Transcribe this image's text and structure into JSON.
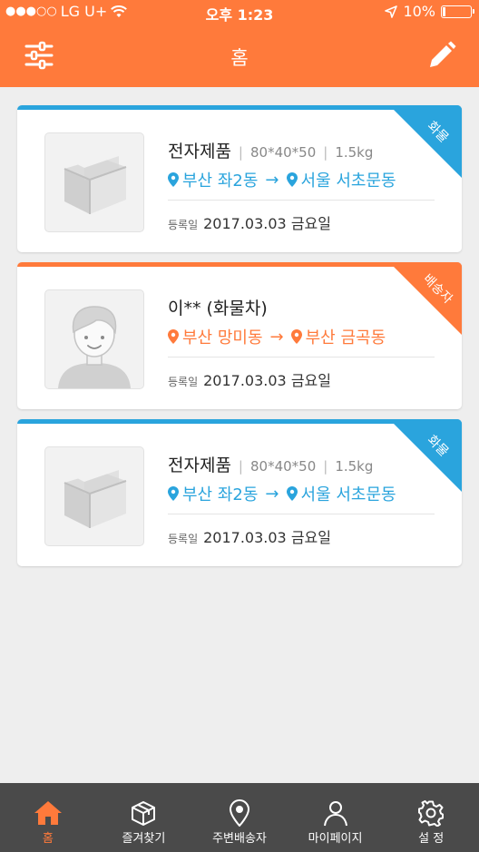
{
  "status_bar": {
    "carrier": "LG U+",
    "signal_dots": "●●●○○",
    "time": "오후 1:23",
    "battery": "10%",
    "battery_level": 0.1
  },
  "header": {
    "title": "홈",
    "filter_icon": "sliders-icon",
    "edit_icon": "pencil-icon"
  },
  "colors": {
    "brand_orange": "#ff7a3b",
    "brand_blue": "#2aa4dd",
    "tabbar_bg": "#4a4a4a"
  },
  "cards": [
    {
      "type": "cargo",
      "badge": "화물",
      "title": "전자제품",
      "size": "80*40*50",
      "weight": "1.5kg",
      "from": "부산 좌2동",
      "arrow": "→",
      "to": "서울 서초문동",
      "reg_label": "등록일",
      "reg_date": "2017.03.03 금요일"
    },
    {
      "type": "driver",
      "badge": "배송자",
      "title": "이** (화물차)",
      "from": "부산 망미동",
      "arrow": "→",
      "to": "부산 금곡동",
      "reg_label": "등록일",
      "reg_date": "2017.03.03 금요일"
    },
    {
      "type": "cargo",
      "badge": "화물",
      "title": "전자제품",
      "size": "80*40*50",
      "weight": "1.5kg",
      "from": "부산 좌2동",
      "arrow": "→",
      "to": "서울 서초문동",
      "reg_label": "등록일",
      "reg_date": "2017.03.03 금요일"
    }
  ],
  "tabbar": [
    {
      "label": "홈",
      "icon": "home-icon",
      "active": true
    },
    {
      "label": "즐겨찾기",
      "icon": "box-icon",
      "active": false
    },
    {
      "label": "주변배송자",
      "icon": "location-pin-icon",
      "active": false
    },
    {
      "label": "마이페이지",
      "icon": "person-icon",
      "active": false
    },
    {
      "label": "설 정",
      "icon": "gear-icon",
      "active": false
    }
  ]
}
